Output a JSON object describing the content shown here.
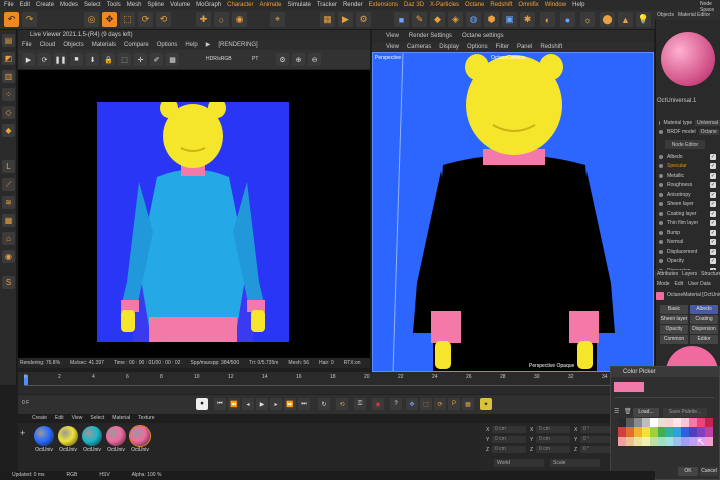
{
  "menubar": {
    "items": [
      "File",
      "Edit",
      "Create",
      "Modes",
      "Select",
      "Tools",
      "Mesh",
      "Spline",
      "Volume",
      "MoGraph",
      "Character",
      "Animate",
      "Simulate",
      "Tracker",
      "Render",
      "Extensions",
      "Daz 3D",
      "X-Particles",
      "Octane",
      "Redshift",
      "Omnifix",
      "Window",
      "Help"
    ],
    "highlight": [
      "Character",
      "Animate",
      "Extensions",
      "Daz 3D",
      "X-Particles",
      "Octane",
      "Redshift",
      "Omnifix",
      "Window"
    ],
    "right_label": "Node Space"
  },
  "live_viewer": {
    "title": "Live Viewer 2021.1.5-(R4) (9 days left)",
    "menu": [
      "File",
      "Cloud",
      "Objects",
      "Materials",
      "Compare",
      "Options",
      "Help",
      "▶",
      "[RENDERING]"
    ],
    "color_mode": "HDR/sRGB",
    "pt": "PT",
    "status": [
      "Rendering: 76.8%",
      "Ms/sec: 41.397",
      "Time : 00 : 00 : 01/00 : 00 : 02",
      "Spp/maxspp: 384/500",
      "Tri: 0/5.735m",
      "Mesh: 56",
      "Hair: 0",
      "RTX:on",
      "GPU:",
      "85",
      "NetRendering"
    ]
  },
  "viewport": {
    "tabs": [
      "View",
      "Render Settings",
      "Octane settings"
    ],
    "menu": [
      "View",
      "Cameras",
      "Display",
      "Options",
      "Filter",
      "Panel",
      "Redshift"
    ],
    "corner_label": "Perspective",
    "camera_label": "OctaneCamera",
    "bottom_label": "Perspective Opaque"
  },
  "right_panel": {
    "tabs": [
      "Objects",
      "Material Editor"
    ],
    "material_name": "OctUniversal.1",
    "material_type_label": "Material type",
    "material_type_value": "Universal",
    "brdf_label": "BRDF model",
    "brdf_value": "Octane",
    "node_editor_label": "Node Editor",
    "channels": [
      {
        "label": "Albedo",
        "checked": true,
        "highlight": false
      },
      {
        "label": "Specular",
        "checked": true,
        "highlight": true
      },
      {
        "label": "Metallic",
        "checked": true,
        "highlight": false
      },
      {
        "label": "Roughness",
        "checked": true,
        "highlight": false
      },
      {
        "label": "Anisotropy",
        "checked": true,
        "highlight": false
      },
      {
        "label": "Sheen layer",
        "checked": true,
        "highlight": false
      },
      {
        "label": "Coating layer",
        "checked": true,
        "highlight": false
      },
      {
        "label": "Thin film layer",
        "checked": true,
        "highlight": false
      },
      {
        "label": "Bump",
        "checked": true,
        "highlight": false
      },
      {
        "label": "Normal",
        "checked": true,
        "highlight": false
      },
      {
        "label": "Displacement",
        "checked": true,
        "highlight": false
      },
      {
        "label": "Opacity",
        "checked": true,
        "highlight": false
      },
      {
        "label": "Dispersion",
        "checked": true,
        "highlight": false
      }
    ],
    "attr_tabs": [
      "Attributes",
      "Layers",
      "Structure"
    ],
    "attr_menu": [
      "Mode",
      "Edit",
      "User Data"
    ],
    "attr_material": "OctaneMaterial [OctUniversal.1]",
    "attr_buttons": [
      "Basic",
      "Albedo",
      "Sheen layer",
      "Coating layer",
      "Opacity",
      "Dispersion",
      "Common",
      "Editor"
    ]
  },
  "timeline": {
    "ticks": [
      "0",
      "2",
      "4",
      "6",
      "8",
      "10",
      "12",
      "14",
      "16",
      "18",
      "20",
      "22",
      "24",
      "26",
      "28",
      "30",
      "32",
      "34",
      "36"
    ],
    "frame": "0 F"
  },
  "material_manager": {
    "menu": [
      "Create",
      "Edit",
      "View",
      "Select",
      "Material",
      "Texture"
    ],
    "materials": [
      {
        "label": "OctUniv",
        "color": "#2a6cff"
      },
      {
        "label": "OctUniv",
        "color": "#f0e23a"
      },
      {
        "label": "OctUniv",
        "color": "#1eb6c8"
      },
      {
        "label": "OctUniv",
        "color": "#f06aa0"
      },
      {
        "label": "OctUniv",
        "color": "#f06aa0"
      }
    ]
  },
  "coords": {
    "fields": [
      "0 cm",
      "0 cm",
      "0 cm",
      "0 cm",
      "0 cm",
      "0 cm",
      "0 °",
      "0 °",
      "0 °"
    ],
    "axes": [
      "X",
      "Y",
      "Z"
    ],
    "mode1": "World",
    "mode2": "Scale"
  },
  "color_picker": {
    "title": "Color Picker",
    "load_label": "Load...",
    "save_label": "Save Palette...",
    "ok_label": "OK",
    "cancel_label": "Cancel",
    "current_color": "#f27aaa"
  },
  "statusbar": {
    "items": [
      "Updated: 0 ms",
      "RGB",
      "HSV",
      "Alpha: 100 %"
    ]
  },
  "colors": {
    "accent": "#f08a1e",
    "viewport_bg": "#2c66ff",
    "render_bg": "#2a36f5",
    "pink": "#f06aa0",
    "yellow": "#f5e62c"
  }
}
